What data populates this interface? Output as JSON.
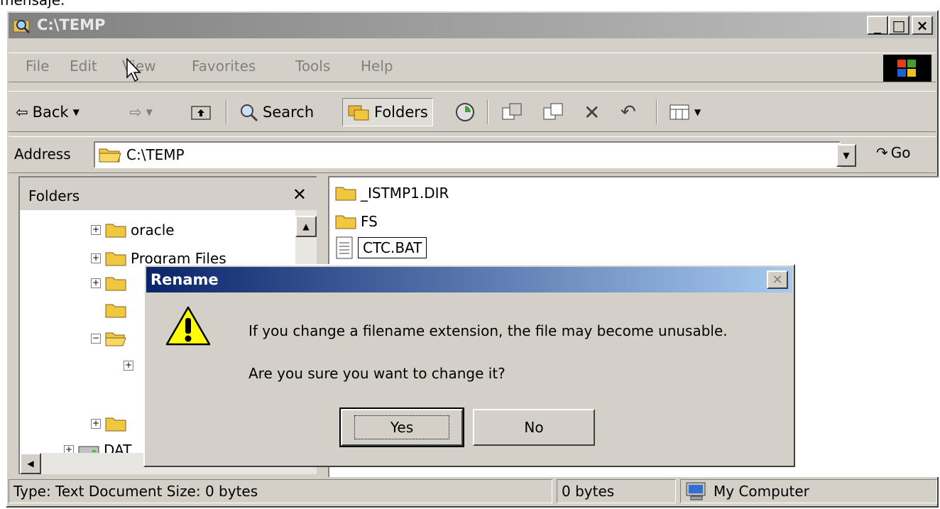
{
  "top_text": "mensaje.",
  "window": {
    "title": "C:\\TEMP",
    "controls": {
      "minimize": "_",
      "maximize": "□",
      "close": "×"
    }
  },
  "menu": {
    "file": "File",
    "edit": "Edit",
    "view": "View",
    "favorites": "Favorites",
    "tools": "Tools",
    "help": "Help"
  },
  "toolbar": {
    "back": "Back",
    "search": "Search",
    "folders": "Folders"
  },
  "address": {
    "label": "Address",
    "value": "C:\\TEMP",
    "go": "Go"
  },
  "folders_pane": {
    "header": "Folders",
    "items": [
      {
        "label": "oracle"
      },
      {
        "label": "Program Files"
      },
      {
        "label": ""
      },
      {
        "label": ""
      },
      {
        "label": ""
      },
      {
        "label": ""
      },
      {
        "label": ""
      },
      {
        "label": ""
      },
      {
        "label": "DAT"
      }
    ]
  },
  "files": [
    {
      "name": "_ISTMP1.DIR",
      "icon": "folder-icon"
    },
    {
      "name": "FS",
      "icon": "folder-icon"
    },
    {
      "name": "CTC.BAT",
      "icon": "text-file-icon"
    }
  ],
  "status": {
    "left": "Type: Text Document Size: 0 bytes",
    "size": "0 bytes",
    "zone": "My Computer"
  },
  "dialog": {
    "title": "Rename",
    "message1": "If you change a filename extension, the file may become unusable.",
    "message2": "Are you sure you want to change it?",
    "yes": "Yes",
    "no": "No"
  }
}
